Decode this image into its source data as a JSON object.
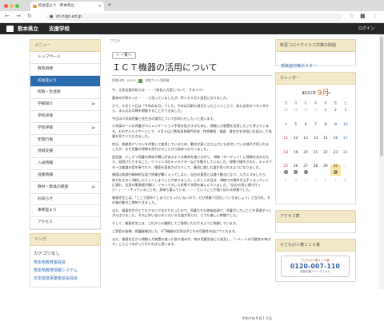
{
  "browser": {
    "tab_title": "校長室より - 熊本県立",
    "url": "sh.higo.ed.jp"
  },
  "site": {
    "title": "熊本県立　　支援学校",
    "login": "ログイン"
  },
  "menu": {
    "header": "メニュー",
    "items": [
      {
        "label": "トップページ",
        "arrow": ""
      },
      {
        "label": "教育目標",
        "arrow": ""
      },
      {
        "label": "校長室より",
        "arrow": "",
        "active": true
      },
      {
        "label": "校歌・生徒歌",
        "arrow": ""
      },
      {
        "label": "学部紹介",
        "arrow": ">"
      },
      {
        "label": "学校評価",
        "arrow": ""
      },
      {
        "label": "学習評価",
        "arrow": ">"
      },
      {
        "label": "年間行事",
        "arrow": ""
      },
      {
        "label": "地域支援",
        "arrow": ""
      },
      {
        "label": "入試情報",
        "arrow": ""
      },
      {
        "label": "進路情報",
        "arrow": ""
      },
      {
        "label": "教材・教具の部屋",
        "arrow": ">"
      },
      {
        "label": "お知らせ",
        "arrow": ""
      },
      {
        "label": "事務室より",
        "arrow": ""
      },
      {
        "label": "アクセス",
        "arrow": ""
      }
    ]
  },
  "links": {
    "header": "リンク",
    "category_title": "カテゴリなし",
    "items": [
      "熊本県教育委員会",
      "熊本県教育情報システム",
      "日本放送事業者協会員会"
    ]
  },
  "post": {
    "blog_label": "ブログ",
    "back_label": "一覧へ",
    "title": "ＩＣＴ機器の活用について",
    "meta_date": "投稿日時 : 09/15",
    "meta_author": "学校サイト管理者",
    "paragraphs": [
      "今、元気支援学校では・・・（校長入力室について　その３９）",
      "夏休みが終わった・・・と思っていましたが、早くも９月２週目になりました。",
      "さて、９月１９日は「今年のお月」でした。今年は月齢も満月だったということで、私も自宅のベランダから、まん丸お月様を堪能することができました。",
      "今日は小学部児童と先生方の描写についてお知らせしたいと思います。",
      "小学部の一人の児童がコミュニケーション手段を拡大するために、視線入力装置を活用したいと考えています。そのアドバイザーとして、９月９日に熊本高専専門学校　特命教授　福島　勇先生を学校にお迎えして授業を見ていただきました。",
      "何分、校務用パソコンを代替して使用しているため、動作が速く立ち上げにも苦労している様子が見られましたが、まず児童の視線を合わせることから始められていました。",
      "設定後、少しずつ児童の興味や関心があるような教材を使いながら、視線（ターゲット）に視線を合わせたり、見続けたりすること、ウイリンゴのキャラクターなどを動かしていました。視線で操作された、キャラクターは楽器の音を奏でたり、場面を変化させたりして、最初に楽しむ姿が見られるようになりました。",
      "普段は体調や精神的な面で授業が難く入ってしまい、自分の意思とは違う動きになり、入力ミスをしたり、体力を大きく消耗したりしてしまうことがありました。しかしこの日は、視線での操作が上手くなっていくに連れ、全身の緊張感が解け、リラックスした状態で学習を楽しんでいました。「自分の思い通り行った！」・・・そっていることを、身体も喜んでいる、・・・ということが強く伝わる授業でした。",
      "福島先生には、「ここで諦めてしまうともったいないので、ぜひ授業で活用していきましょう」と言われ、その後の動きに期待できました。",
      "また、福島先生がとてもフランクなかただったので、児童たちも終始笑顔で、児童がしたいことを表現すべくがんばりました。それに伴い自らのいろいろな姿が見られ、とても楽しい時間でした。",
      "そして、福島先生には、これからも継続してご指導いただけるように依頼しています。",
      "ご家庭の皆様、保護者様方にも、ICT機器の活用は子どもの可能性を広げてくれます。",
      "また、福島先生から視線入力装置を使った取り組みが、他の児童生徒にも波及し、「一人一人の可能性を伸ばす」ことにつながって行ければと思います。"
    ],
    "date": "令和４年９月１２日"
  },
  "right": {
    "corona_header": "新型コロナウイルス対策の取組",
    "corona_link": "感染症対策ポスター",
    "calendar_header": "カレンダー",
    "access_header": "アクセス数",
    "counter_header": "子どもの人権１１０番",
    "phone_top": "子どもの人権１１０番",
    "phone_number": "0120-007-110",
    "phone_bottom": "全国共通フリーダイヤル"
  },
  "calendar": {
    "year": "2022年",
    "month": "9月",
    "prev": "<",
    "next": ">",
    "weekdays": [
      "日",
      "月",
      "火",
      "水",
      "木",
      "金",
      "土"
    ],
    "cells": [
      {
        "d": "28",
        "c": "gray"
      },
      {
        "d": "29",
        "c": "gray"
      },
      {
        "d": "30",
        "c": "gray"
      },
      {
        "d": "31",
        "c": "gray"
      },
      {
        "d": "1",
        "c": ""
      },
      {
        "d": "2",
        "c": ""
      },
      {
        "d": "3",
        "c": "sat"
      },
      {
        "d": "4",
        "c": "sun"
      },
      {
        "d": "5",
        "c": ""
      },
      {
        "d": "6",
        "c": ""
      },
      {
        "d": "7",
        "c": ""
      },
      {
        "d": "8",
        "c": ""
      },
      {
        "d": "9",
        "c": ""
      },
      {
        "d": "10",
        "c": "sat"
      },
      {
        "d": "11",
        "c": "sun"
      },
      {
        "d": "12",
        "c": ""
      },
      {
        "d": "13",
        "c": ""
      },
      {
        "d": "14",
        "c": ""
      },
      {
        "d": "15",
        "c": ""
      },
      {
        "d": "16",
        "c": ""
      },
      {
        "d": "17",
        "c": "sat"
      },
      {
        "d": "18",
        "c": "sun"
      },
      {
        "d": "19",
        "c": ""
      },
      {
        "d": "20",
        "c": ""
      },
      {
        "d": "21",
        "c": ""
      },
      {
        "d": "22",
        "c": ""
      },
      {
        "d": "23",
        "c": ""
      },
      {
        "d": "24",
        "c": "sat"
      },
      {
        "d": "25",
        "c": "sun",
        "b": "2"
      },
      {
        "d": "26",
        "c": "",
        "b": "1"
      },
      {
        "d": "27",
        "c": "",
        "b": "1"
      },
      {
        "d": "28",
        "c": ""
      },
      {
        "d": "29",
        "c": ""
      },
      {
        "d": "30",
        "c": "today",
        "b": "2"
      },
      {
        "d": "1",
        "c": "gray"
      },
      {
        "d": "2",
        "c": "gray"
      },
      {
        "d": "3",
        "c": "gray"
      },
      {
        "d": "4",
        "c": "gray"
      },
      {
        "d": "5",
        "c": "gray"
      },
      {
        "d": "6",
        "c": "gray"
      },
      {
        "d": "7",
        "c": "gray"
      },
      {
        "d": "8",
        "c": "gray"
      }
    ]
  }
}
